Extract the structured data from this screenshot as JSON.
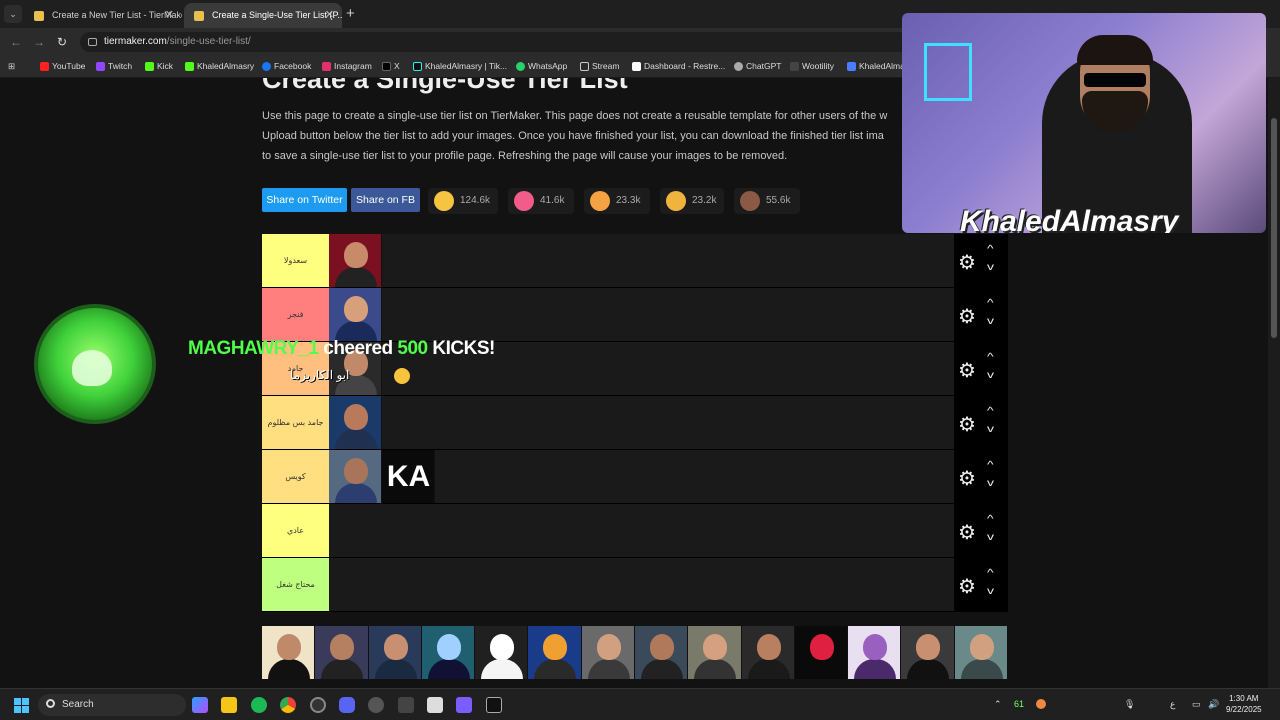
{
  "browser": {
    "tabs": [
      {
        "title": "Create a New Tier List - TierMaker"
      },
      {
        "title": "Create a Single-Use Tier List (P..."
      }
    ],
    "url_host": "tiermaker.com",
    "url_path": "/single-use-tier-list/",
    "bookmarks": [
      "YouTube",
      "Twitch",
      "Kick",
      "KhaledAlmasry",
      "Facebook",
      "Instagram",
      "X",
      "KhaledAlmasry | Tik...",
      "WhatsApp",
      "Stream",
      "Dashboard - Restre...",
      "ChatGPT",
      "Wootility",
      "KhaledAlma"
    ]
  },
  "page": {
    "title": "Create a Single-Use Tier List",
    "intro_lines": [
      "Use this page to create a single-use tier list on TierMaker. This page does not create a reusable template for other users of the w",
      "Upload button below the tier list to add your images. Once you have finished your list, you can download the finished tier list ima",
      "to save a single-use tier list to your profile page. Refreshing the page will cause your images to be removed."
    ],
    "share_twitter": "Share on Twitter",
    "share_fb": "Share on FB",
    "reactions": [
      {
        "icon": "grin-emoji-icon",
        "count": "124.6k",
        "color": "#f5c542"
      },
      {
        "icon": "heart-eyes-emoji-icon",
        "count": "41.6k",
        "color": "#f25c8a"
      },
      {
        "icon": "laugh-emoji-icon",
        "count": "23.3k",
        "color": "#f5a342"
      },
      {
        "icon": "praise-hands-emoji-icon",
        "count": "23.2k",
        "color": "#f0b43c"
      },
      {
        "icon": "poop-emoji-icon",
        "count": "55.6k",
        "color": "#8a5a44"
      }
    ]
  },
  "tiers": [
    {
      "label": "سعدولا",
      "color": "#ffff7f",
      "items": [
        {
          "face": "#c98a6a",
          "bg": "#7a1020",
          "body": "#222"
        }
      ]
    },
    {
      "label": "فنجر",
      "color": "#ff7f7f",
      "items": [
        {
          "face": "#d8a07a",
          "bg": "#3a4a8a",
          "body": "#1a2a5a"
        }
      ]
    },
    {
      "label": "جامد",
      "color": "#ffbf7f",
      "items": [
        {
          "face": "#c08a6a",
          "bg": "#2a2a2a",
          "body": "#444"
        }
      ]
    },
    {
      "label": "جامد بس مظلوم",
      "color": "#ffdf7f",
      "items": [
        {
          "face": "#b87a5a",
          "bg": "#1a3a6a",
          "body": "#203050"
        }
      ]
    },
    {
      "label": "كويس",
      "color": "#ffdf7f",
      "items": [
        {
          "face": "#a8745a",
          "bg": "#556a80",
          "body": "#2c3e70"
        },
        {
          "face": "#000",
          "bg": "#0a0a0a",
          "body": "#0a0a0a",
          "logo": "KA"
        }
      ]
    },
    {
      "label": "عادي",
      "color": "#ffff7f",
      "items": []
    },
    {
      "label": "محتاج شغل",
      "color": "#bfff7f",
      "items": []
    }
  ],
  "pool": [
    {
      "face": "#c08a6a",
      "bg": "#f0e4c8",
      "body": "#111"
    },
    {
      "face": "#b58060",
      "bg": "#3a3a5a",
      "body": "#222"
    },
    {
      "face": "#c89070",
      "bg": "#2a3a5a",
      "body": "#1a2a40"
    },
    {
      "face": "#9fd0ff",
      "bg": "#1f5f6f",
      "body": "#113"
    },
    {
      "face": "#ffffff",
      "bg": "#202020",
      "body": "#f5f5f5"
    },
    {
      "face": "#f0a030",
      "bg": "#1a3a8a",
      "body": "#2a2a2a"
    },
    {
      "face": "#d0a080",
      "bg": "#6a6a6a",
      "body": "#3a3a3a"
    },
    {
      "face": "#b07a5a",
      "bg": "#3a4a5a",
      "body": "#222"
    },
    {
      "face": "#d4a080",
      "bg": "#7a7a6a",
      "body": "#333"
    },
    {
      "face": "#b88060",
      "bg": "#2a2a2a",
      "body": "#1a1a1a"
    },
    {
      "face": "#e02040",
      "bg": "#0a0a0a",
      "body": "#0a0a0a"
    },
    {
      "face": "#9a60c0",
      "bg": "#e8e0f0",
      "body": "#4a2a6a"
    },
    {
      "face": "#c89070",
      "bg": "#3a3a3a",
      "body": "#111"
    },
    {
      "face": "#d0a080",
      "bg": "#6a8a8a",
      "body": "#3a4a4a"
    }
  ],
  "overlay": {
    "streamer_name": "KhaledAlmasry",
    "alert_user": "MAGHAWRY_1",
    "alert_mid": " cheered ",
    "alert_amount": "500",
    "alert_unit": " KICKS!",
    "alert_message": "ابو الكاريزما"
  },
  "taskbar": {
    "search_placeholder": "Search",
    "tray_count": "61",
    "lang": "ع",
    "time": "1:30 AM",
    "date": "9/22/2025"
  }
}
